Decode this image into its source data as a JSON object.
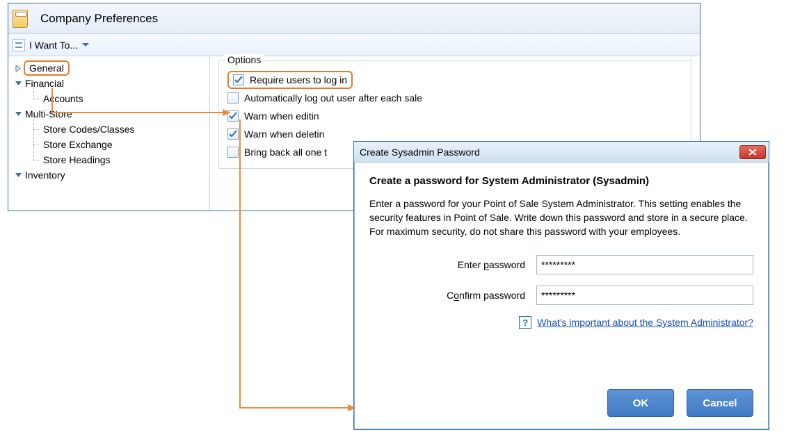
{
  "pref": {
    "title": "Company Preferences",
    "iwantto": "I Want To...",
    "tree": {
      "general": "General",
      "financial": "Financial",
      "accounts": "Accounts",
      "multistore": "Multi-Store",
      "storecodes": "Store Codes/Classes",
      "storeexchange": "Store Exchange",
      "storeheadings": "Store Headings",
      "inventory": "Inventory"
    },
    "options": {
      "legend": "Options",
      "require_login": "Require users to log in",
      "auto_logout": "Automatically log out user after each sale",
      "warn_edit": "Warn when editin",
      "warn_delete": "Warn when deletin",
      "bring_back": "Bring back all one t"
    }
  },
  "dlg": {
    "title": "Create Sysadmin Password",
    "heading": "Create a password for System Administrator (Sysadmin)",
    "desc": "Enter a password for your Point of Sale System Administrator. This setting enables the security features in Point of Sale.  Write down this password and store in a secure place. For maximum security, do not share this password with your employees.",
    "enter_prefix": "Enter ",
    "enter_hot": "p",
    "enter_suffix": "assword",
    "confirm_prefix": "C",
    "confirm_hot": "o",
    "confirm_suffix": "nfirm password",
    "pw_value": "*********",
    "help_link": "What's important about the System Administrator?",
    "ok": "OK",
    "cancel": "Cancel"
  }
}
